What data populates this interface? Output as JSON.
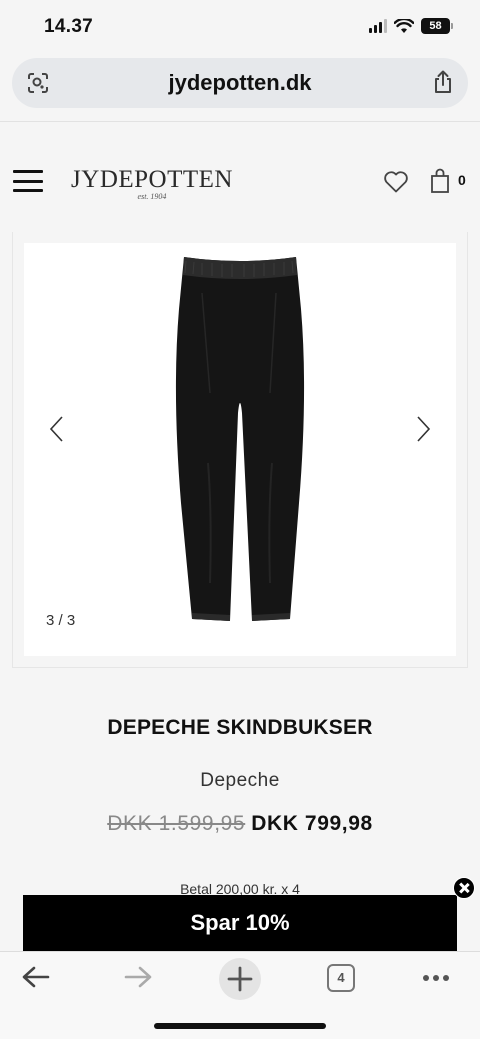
{
  "status": {
    "time": "14.37",
    "battery": "58"
  },
  "browser": {
    "url": "jydepotten.dk",
    "tab_count": "4"
  },
  "site": {
    "logo": "JYDEPOTTEN",
    "logo_sub": "est. 1904",
    "cart_count": "0"
  },
  "gallery": {
    "counter": "3 / 3"
  },
  "product": {
    "title": "DEPECHE SKINDBUKSER",
    "brand": "Depeche",
    "old_price": "DKK 1.599,95",
    "price": "DKK 799,98",
    "installment": "Betal 200,00 kr. x 4"
  },
  "promo": {
    "label": "Spar 10%"
  },
  "icons": {
    "menu": "hamburger-menu-icon",
    "wishlist": "heart-icon",
    "cart": "shopping-bag-icon",
    "share": "share-icon",
    "lens": "lens-icon",
    "prev": "chevron-left-icon",
    "next": "chevron-right-icon",
    "close": "close-icon",
    "back": "arrow-left-icon",
    "forward": "arrow-right-icon",
    "new_tab": "plus-icon",
    "tabs": "tabs-icon",
    "more": "more-icon"
  }
}
